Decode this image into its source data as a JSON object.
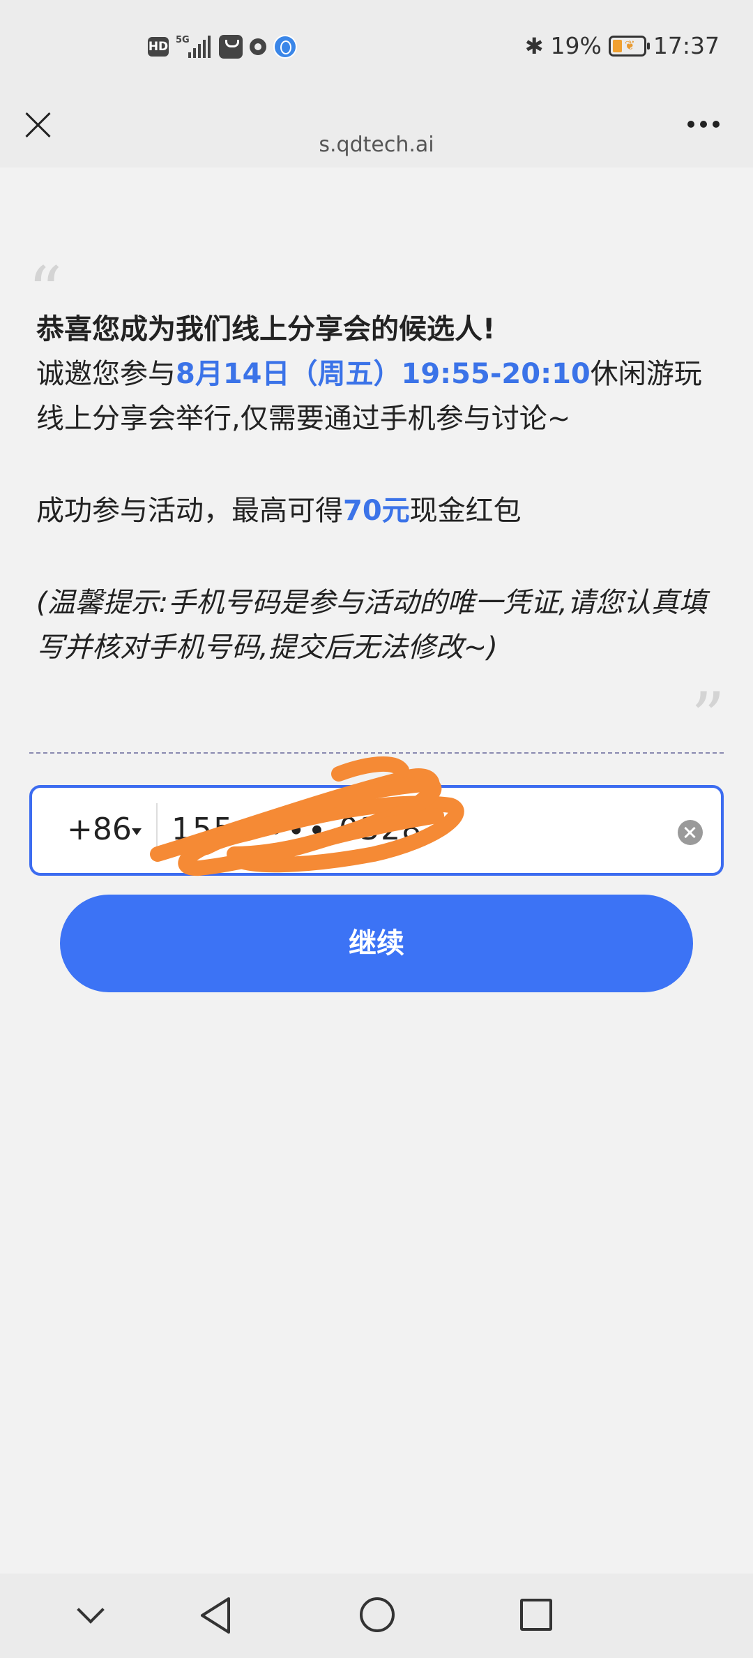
{
  "status": {
    "hd": "HD",
    "network": "5G",
    "battery_pct": "19%",
    "time": "17:37"
  },
  "nav": {
    "url": "s.qdtech.ai"
  },
  "invite": {
    "title": "恭喜您成为我们线上分享会的候选人!",
    "line1_pre": "诚邀您参与",
    "line1_date": "8月14日（周五）19:55-20:10",
    "line1_post": "休闲游玩线上分享会举行,仅需要通过手机参与讨论~",
    "line2_pre": "成功参与活动，最高可得",
    "line2_amount": "70元",
    "line2_post": "现金红包",
    "tip": "(温馨提示:手机号码是参与活动的唯一凭证,请您认真填写并核对手机号码,提交后无法修改~)"
  },
  "form": {
    "country_code": "+86",
    "phone_value": "155 ∙∙∙∙ 0328",
    "submit_label": "继续"
  },
  "colors": {
    "accent": "#3c73f5",
    "highlight": "#3b73e8",
    "scribble": "#f58a35"
  }
}
